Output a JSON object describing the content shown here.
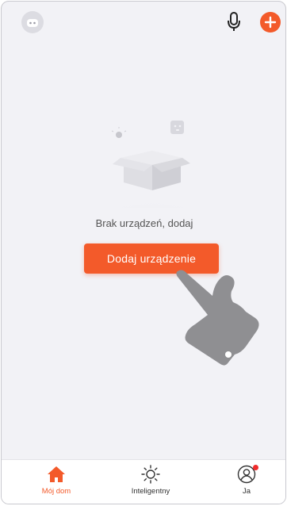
{
  "empty_state": {
    "message": "Brak urządzeń, dodaj",
    "button_label": "Dodaj urządzenie"
  },
  "tabs": [
    {
      "label": "Mój dom",
      "icon": "home-icon",
      "active": true
    },
    {
      "label": "Inteligentny",
      "icon": "sun-icon",
      "active": false
    },
    {
      "label": "Ja",
      "icon": "profile-icon",
      "active": false,
      "badge": true
    }
  ],
  "colors": {
    "accent": "#f35a2a",
    "background": "#f2f2f6",
    "badge": "#f02b2b"
  }
}
